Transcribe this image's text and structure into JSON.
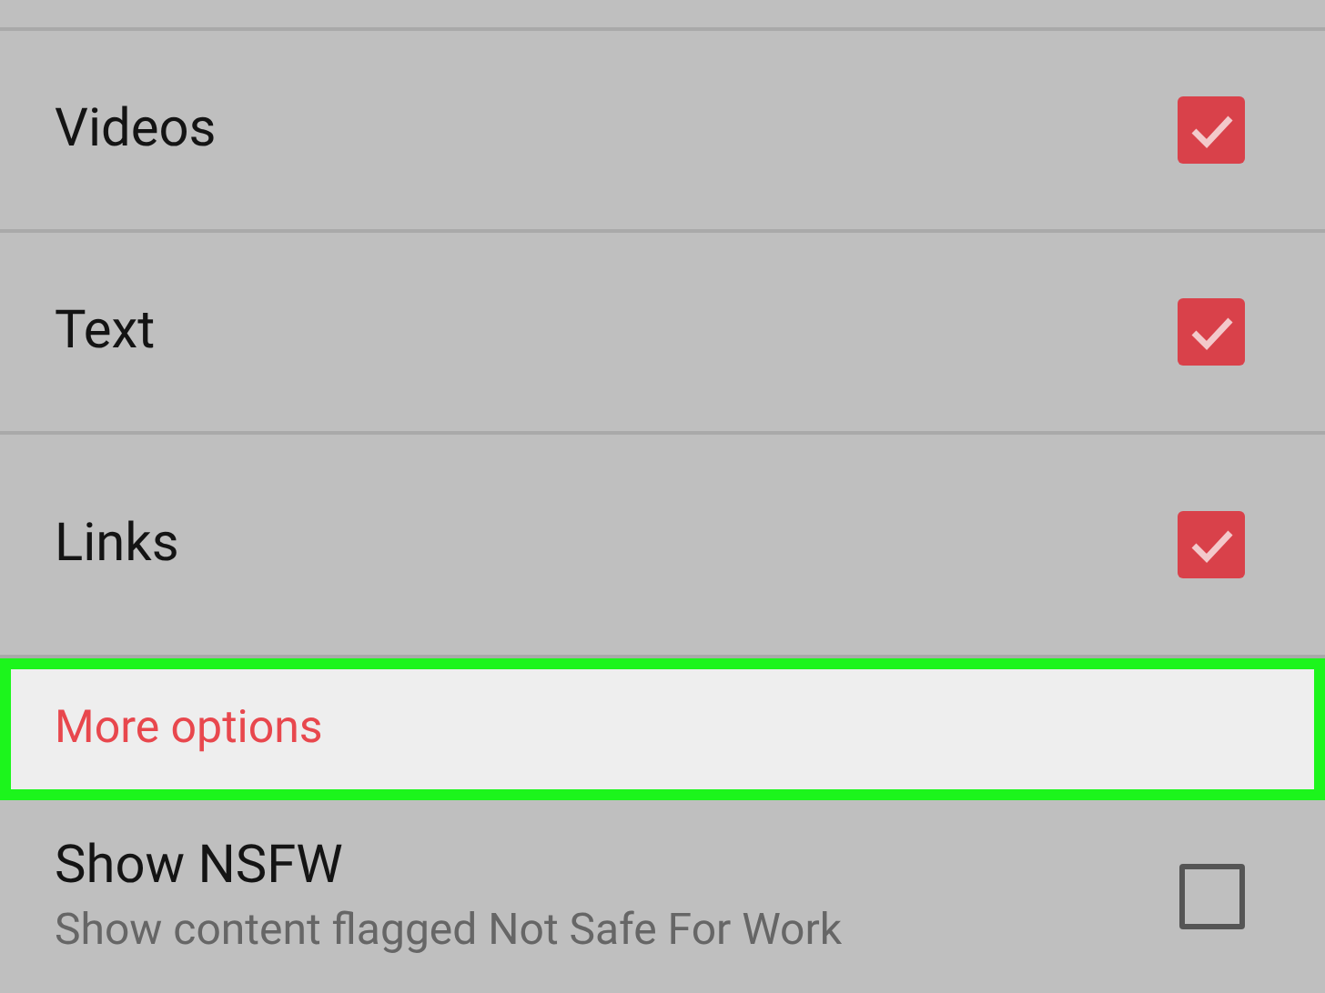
{
  "rows": [
    {
      "label": "Videos",
      "checked": true
    },
    {
      "label": "Text",
      "checked": true
    },
    {
      "label": "Links",
      "checked": true
    }
  ],
  "section": {
    "title": "More options",
    "highlighted": true
  },
  "option": {
    "label": "Show NSFW",
    "description": "Show content flagged Not Safe For Work",
    "checked": false
  }
}
